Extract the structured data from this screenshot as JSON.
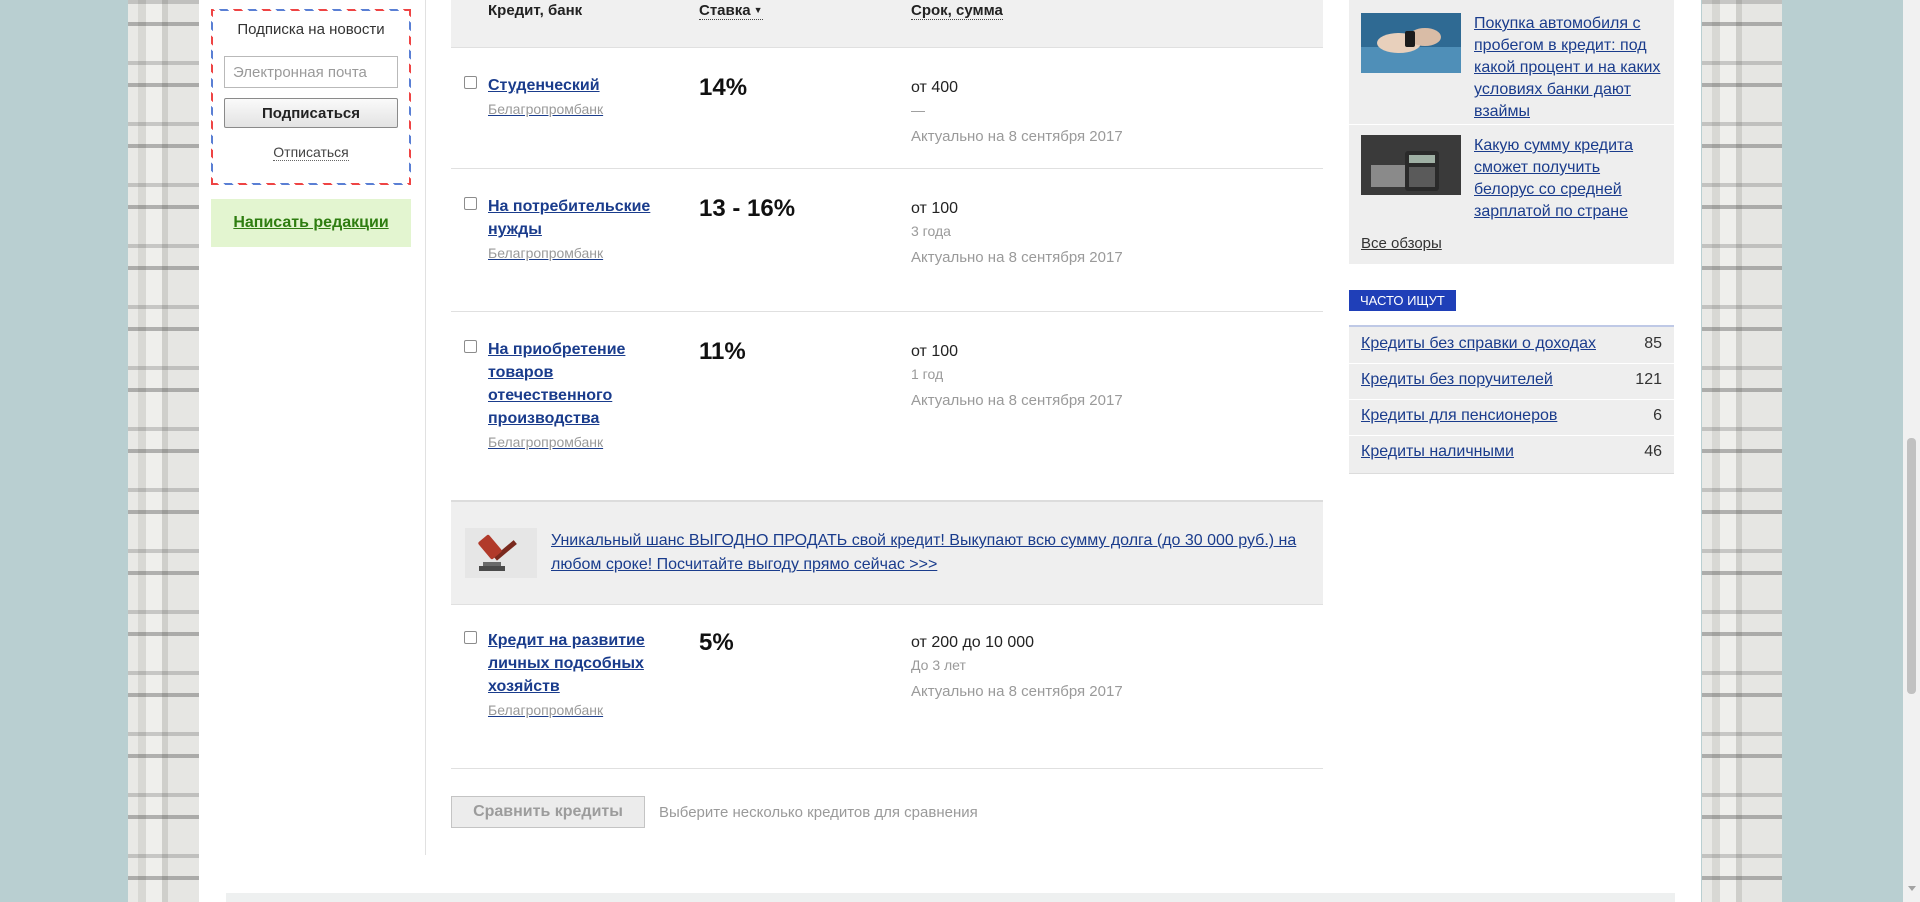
{
  "sidebar_left": {
    "subscribe_title": "Подписка на новости",
    "email_placeholder": "Электронная почта",
    "subscribe_button": "Подписаться",
    "unsubscribe_link": "Отписаться",
    "write_editor_link": "Написать редакции"
  },
  "table": {
    "headers": {
      "credit_bank": "Кредит, банк",
      "rate": "Ставка",
      "term_sum": "Срок, сумма"
    },
    "rows": [
      {
        "name": "Студенческий",
        "bank": "Белагропромбанк",
        "rate": "14%",
        "amount": "от 400",
        "period": "—",
        "actual": "Актуально на 8 сентября 2017"
      },
      {
        "name": "На потребительские нужды",
        "bank": "Белагропромбанк",
        "rate": "13 - 16%",
        "amount": "от 100",
        "period": "3 года",
        "actual": "Актуально на 8 сентября 2017"
      },
      {
        "name": "На приобретение товаров отечественного производства",
        "bank": "Белагропромбанк",
        "rate": "11%",
        "amount": "от 100",
        "period": "1 год",
        "actual": "Актуально на 8 сентября 2017"
      },
      {
        "name": "Кредит на развитие личных подсобных хозяйств",
        "bank": "Белагропромбанк",
        "rate": "5%",
        "amount": "от 200 до 10 000",
        "period": "До 3 лет",
        "actual": "Актуально на 8 сентября 2017"
      }
    ],
    "promo_text": "Уникальный шанс ВЫГОДНО ПРОДАТЬ свой кредит! Выкупают всю сумму долга (до 30 000 руб.) на любом сроке! Посчитайте выгоду прямо сейчас >>>",
    "compare_button": "Сравнить кредиты",
    "compare_hint": "Выберите несколько кредитов для сравнения"
  },
  "sidebar_right": {
    "reviews": [
      {
        "title": "Покупка автомобиля с пробегом в кредит: под какой процент и на каких условиях банки дают взаймы"
      },
      {
        "title": "Какую сумму кредита сможет получить белорус со средней зарплатой по стране"
      }
    ],
    "all_reviews": "Все обзоры",
    "often_title": "Часто ищут",
    "often": [
      {
        "label": "Кредиты без справки о доходах",
        "count": "85"
      },
      {
        "label": "Кредиты без поручителей",
        "count": "121"
      },
      {
        "label": "Кредиты для пенсионеров",
        "count": "6"
      },
      {
        "label": "Кредиты наличными",
        "count": "46"
      }
    ]
  },
  "colors": {
    "link": "#1a3c8c",
    "badge": "#1f3fb8",
    "write_box_bg": "#e3f5d0",
    "write_box_text": "#2e7d10"
  },
  "icons": {
    "promo": "gavel-icon",
    "sort": "caret-down-icon"
  }
}
